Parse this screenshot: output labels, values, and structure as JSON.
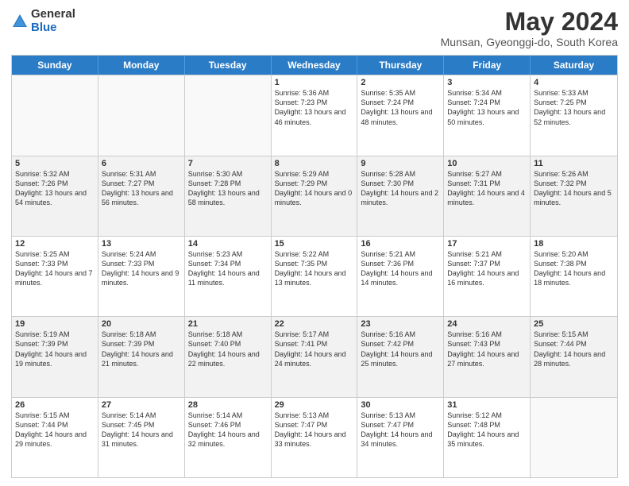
{
  "header": {
    "logo_general": "General",
    "logo_blue": "Blue",
    "month_title": "May 2024",
    "location": "Munsan, Gyeonggi-do, South Korea"
  },
  "days_of_week": [
    "Sunday",
    "Monday",
    "Tuesday",
    "Wednesday",
    "Thursday",
    "Friday",
    "Saturday"
  ],
  "weeks": [
    [
      {
        "day": "",
        "sunrise": "",
        "sunset": "",
        "daylight": ""
      },
      {
        "day": "",
        "sunrise": "",
        "sunset": "",
        "daylight": ""
      },
      {
        "day": "",
        "sunrise": "",
        "sunset": "",
        "daylight": ""
      },
      {
        "day": "1",
        "sunrise": "Sunrise: 5:36 AM",
        "sunset": "Sunset: 7:23 PM",
        "daylight": "Daylight: 13 hours and 46 minutes."
      },
      {
        "day": "2",
        "sunrise": "Sunrise: 5:35 AM",
        "sunset": "Sunset: 7:24 PM",
        "daylight": "Daylight: 13 hours and 48 minutes."
      },
      {
        "day": "3",
        "sunrise": "Sunrise: 5:34 AM",
        "sunset": "Sunset: 7:24 PM",
        "daylight": "Daylight: 13 hours and 50 minutes."
      },
      {
        "day": "4",
        "sunrise": "Sunrise: 5:33 AM",
        "sunset": "Sunset: 7:25 PM",
        "daylight": "Daylight: 13 hours and 52 minutes."
      }
    ],
    [
      {
        "day": "5",
        "sunrise": "Sunrise: 5:32 AM",
        "sunset": "Sunset: 7:26 PM",
        "daylight": "Daylight: 13 hours and 54 minutes."
      },
      {
        "day": "6",
        "sunrise": "Sunrise: 5:31 AM",
        "sunset": "Sunset: 7:27 PM",
        "daylight": "Daylight: 13 hours and 56 minutes."
      },
      {
        "day": "7",
        "sunrise": "Sunrise: 5:30 AM",
        "sunset": "Sunset: 7:28 PM",
        "daylight": "Daylight: 13 hours and 58 minutes."
      },
      {
        "day": "8",
        "sunrise": "Sunrise: 5:29 AM",
        "sunset": "Sunset: 7:29 PM",
        "daylight": "Daylight: 14 hours and 0 minutes."
      },
      {
        "day": "9",
        "sunrise": "Sunrise: 5:28 AM",
        "sunset": "Sunset: 7:30 PM",
        "daylight": "Daylight: 14 hours and 2 minutes."
      },
      {
        "day": "10",
        "sunrise": "Sunrise: 5:27 AM",
        "sunset": "Sunset: 7:31 PM",
        "daylight": "Daylight: 14 hours and 4 minutes."
      },
      {
        "day": "11",
        "sunrise": "Sunrise: 5:26 AM",
        "sunset": "Sunset: 7:32 PM",
        "daylight": "Daylight: 14 hours and 5 minutes."
      }
    ],
    [
      {
        "day": "12",
        "sunrise": "Sunrise: 5:25 AM",
        "sunset": "Sunset: 7:33 PM",
        "daylight": "Daylight: 14 hours and 7 minutes."
      },
      {
        "day": "13",
        "sunrise": "Sunrise: 5:24 AM",
        "sunset": "Sunset: 7:33 PM",
        "daylight": "Daylight: 14 hours and 9 minutes."
      },
      {
        "day": "14",
        "sunrise": "Sunrise: 5:23 AM",
        "sunset": "Sunset: 7:34 PM",
        "daylight": "Daylight: 14 hours and 11 minutes."
      },
      {
        "day": "15",
        "sunrise": "Sunrise: 5:22 AM",
        "sunset": "Sunset: 7:35 PM",
        "daylight": "Daylight: 14 hours and 13 minutes."
      },
      {
        "day": "16",
        "sunrise": "Sunrise: 5:21 AM",
        "sunset": "Sunset: 7:36 PM",
        "daylight": "Daylight: 14 hours and 14 minutes."
      },
      {
        "day": "17",
        "sunrise": "Sunrise: 5:21 AM",
        "sunset": "Sunset: 7:37 PM",
        "daylight": "Daylight: 14 hours and 16 minutes."
      },
      {
        "day": "18",
        "sunrise": "Sunrise: 5:20 AM",
        "sunset": "Sunset: 7:38 PM",
        "daylight": "Daylight: 14 hours and 18 minutes."
      }
    ],
    [
      {
        "day": "19",
        "sunrise": "Sunrise: 5:19 AM",
        "sunset": "Sunset: 7:39 PM",
        "daylight": "Daylight: 14 hours and 19 minutes."
      },
      {
        "day": "20",
        "sunrise": "Sunrise: 5:18 AM",
        "sunset": "Sunset: 7:39 PM",
        "daylight": "Daylight: 14 hours and 21 minutes."
      },
      {
        "day": "21",
        "sunrise": "Sunrise: 5:18 AM",
        "sunset": "Sunset: 7:40 PM",
        "daylight": "Daylight: 14 hours and 22 minutes."
      },
      {
        "day": "22",
        "sunrise": "Sunrise: 5:17 AM",
        "sunset": "Sunset: 7:41 PM",
        "daylight": "Daylight: 14 hours and 24 minutes."
      },
      {
        "day": "23",
        "sunrise": "Sunrise: 5:16 AM",
        "sunset": "Sunset: 7:42 PM",
        "daylight": "Daylight: 14 hours and 25 minutes."
      },
      {
        "day": "24",
        "sunrise": "Sunrise: 5:16 AM",
        "sunset": "Sunset: 7:43 PM",
        "daylight": "Daylight: 14 hours and 27 minutes."
      },
      {
        "day": "25",
        "sunrise": "Sunrise: 5:15 AM",
        "sunset": "Sunset: 7:44 PM",
        "daylight": "Daylight: 14 hours and 28 minutes."
      }
    ],
    [
      {
        "day": "26",
        "sunrise": "Sunrise: 5:15 AM",
        "sunset": "Sunset: 7:44 PM",
        "daylight": "Daylight: 14 hours and 29 minutes."
      },
      {
        "day": "27",
        "sunrise": "Sunrise: 5:14 AM",
        "sunset": "Sunset: 7:45 PM",
        "daylight": "Daylight: 14 hours and 31 minutes."
      },
      {
        "day": "28",
        "sunrise": "Sunrise: 5:14 AM",
        "sunset": "Sunset: 7:46 PM",
        "daylight": "Daylight: 14 hours and 32 minutes."
      },
      {
        "day": "29",
        "sunrise": "Sunrise: 5:13 AM",
        "sunset": "Sunset: 7:47 PM",
        "daylight": "Daylight: 14 hours and 33 minutes."
      },
      {
        "day": "30",
        "sunrise": "Sunrise: 5:13 AM",
        "sunset": "Sunset: 7:47 PM",
        "daylight": "Daylight: 14 hours and 34 minutes."
      },
      {
        "day": "31",
        "sunrise": "Sunrise: 5:12 AM",
        "sunset": "Sunset: 7:48 PM",
        "daylight": "Daylight: 14 hours and 35 minutes."
      },
      {
        "day": "",
        "sunrise": "",
        "sunset": "",
        "daylight": ""
      }
    ]
  ]
}
